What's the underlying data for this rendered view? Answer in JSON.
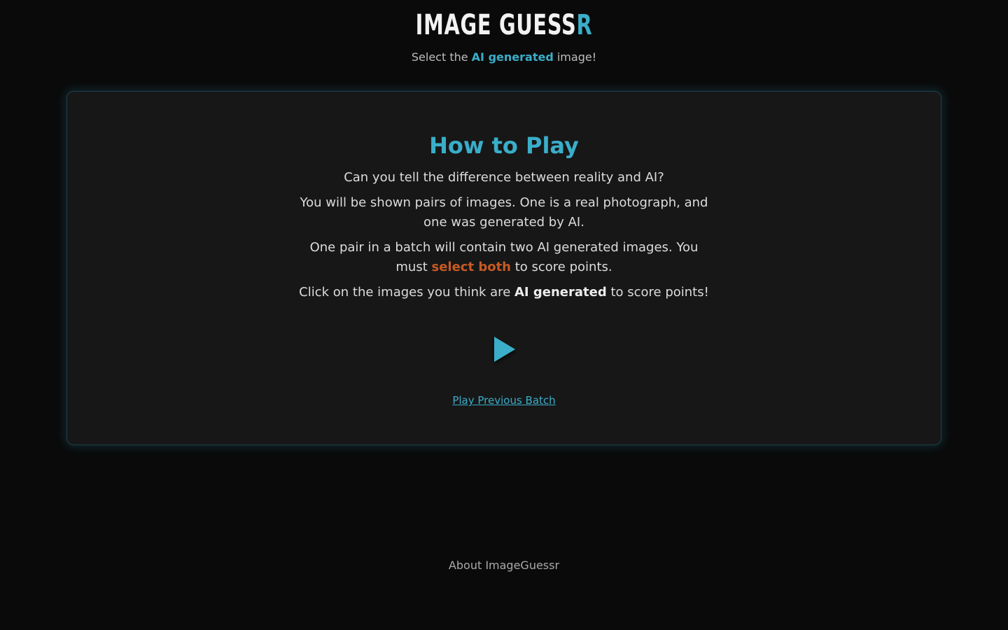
{
  "header": {
    "logo_main": "IMAGE GUESS",
    "logo_accent": "R",
    "tagline_before": "Select the ",
    "tagline_highlight": "AI generated",
    "tagline_after": " image!"
  },
  "card": {
    "title": "How to Play",
    "p1": "Can you tell the difference between reality and AI?",
    "p2": "You will be shown pairs of images. One is a real photograph, and one was generated by AI.",
    "p3_before": "One pair in a batch will contain two AI generated images. You must ",
    "p3_highlight": "select both",
    "p3_after": " to score points.",
    "p4_before": "Click on the images you think are ",
    "p4_bold": "AI generated",
    "p4_after": " to score points!",
    "play_icon": "play-triangle-icon",
    "prev_link": "Play Previous Batch"
  },
  "footer": {
    "about_link": "About ImageGuessr"
  },
  "colors": {
    "background": "#0a0a0a",
    "card": "#171717",
    "accent": "#3aaec9",
    "highlight_orange": "#c75a23"
  }
}
